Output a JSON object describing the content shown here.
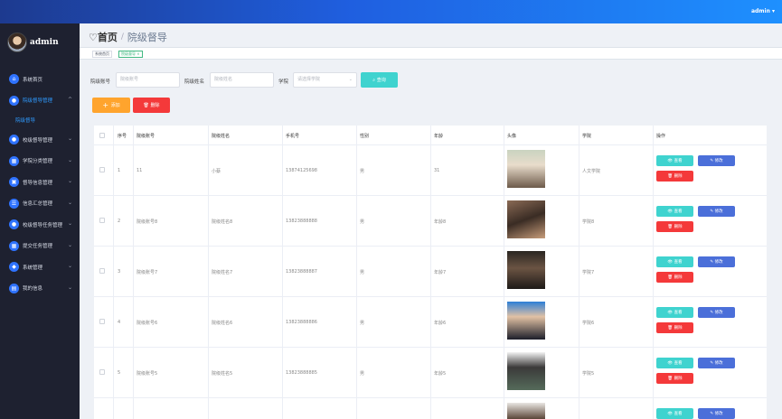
{
  "topbar": {
    "user": "admin"
  },
  "sidebar": {
    "username": "admin",
    "items": [
      {
        "label": "系统首页",
        "icon": "home-icon",
        "glyph": "⌂"
      },
      {
        "label": "院级督导管理",
        "icon": "user-icon",
        "glyph": "●",
        "active": true
      },
      {
        "label": "校级督导管理",
        "icon": "user-icon",
        "glyph": "●"
      },
      {
        "label": "学院分类管理",
        "icon": "grid-icon",
        "glyph": "▦"
      },
      {
        "label": "督导信息管理",
        "icon": "doc-icon",
        "glyph": "▣"
      },
      {
        "label": "信息汇总管理",
        "icon": "list-icon",
        "glyph": "☰"
      },
      {
        "label": "校级督导任务管理",
        "icon": "task-icon",
        "glyph": "●"
      },
      {
        "label": "提交任务管理",
        "icon": "grid-icon",
        "glyph": "▦"
      },
      {
        "label": "系统管理",
        "icon": "shield-icon",
        "glyph": "◆"
      },
      {
        "label": "我的信息",
        "icon": "profile-icon",
        "glyph": "▤"
      }
    ],
    "sub_item": "院级督导"
  },
  "breadcrumb": {
    "home": "首页",
    "sep": "/",
    "current": "院级督导"
  },
  "tabs": [
    "系统首页",
    "院级督导 ×"
  ],
  "search": {
    "account_label": "院级账号",
    "account_placeholder": "院级账号",
    "name_label": "院级姓名",
    "name_placeholder": "院级姓名",
    "college_label": "学院",
    "college_placeholder": "请选择学院",
    "search_button": "查询"
  },
  "actions": {
    "add": "添加",
    "delete": "删除"
  },
  "table": {
    "headers": [
      "序号",
      "院级账号",
      "院级姓名",
      "手机号",
      "性别",
      "年龄",
      "头像",
      "学院",
      "操作"
    ],
    "rows": [
      {
        "idx": "1",
        "account": "11",
        "name": "小蔡",
        "phone": "13874125698",
        "gender": "男",
        "age": "31",
        "college": "人文学院"
      },
      {
        "idx": "2",
        "account": "院级账号8",
        "name": "院级姓名8",
        "phone": "13823888888",
        "gender": "男",
        "age": "年龄8",
        "college": "学院8"
      },
      {
        "idx": "3",
        "account": "院级账号7",
        "name": "院级姓名7",
        "phone": "13823888887",
        "gender": "男",
        "age": "年龄7",
        "college": "学院7"
      },
      {
        "idx": "4",
        "account": "院级账号6",
        "name": "院级姓名6",
        "phone": "13823888886",
        "gender": "男",
        "age": "年龄6",
        "college": "学院6"
      },
      {
        "idx": "5",
        "account": "院级账号5",
        "name": "院级姓名5",
        "phone": "13823888885",
        "gender": "男",
        "age": "年龄5",
        "college": "学院5"
      }
    ],
    "view_label": "查看",
    "edit_label": "修改",
    "delete_label": "删除"
  }
}
